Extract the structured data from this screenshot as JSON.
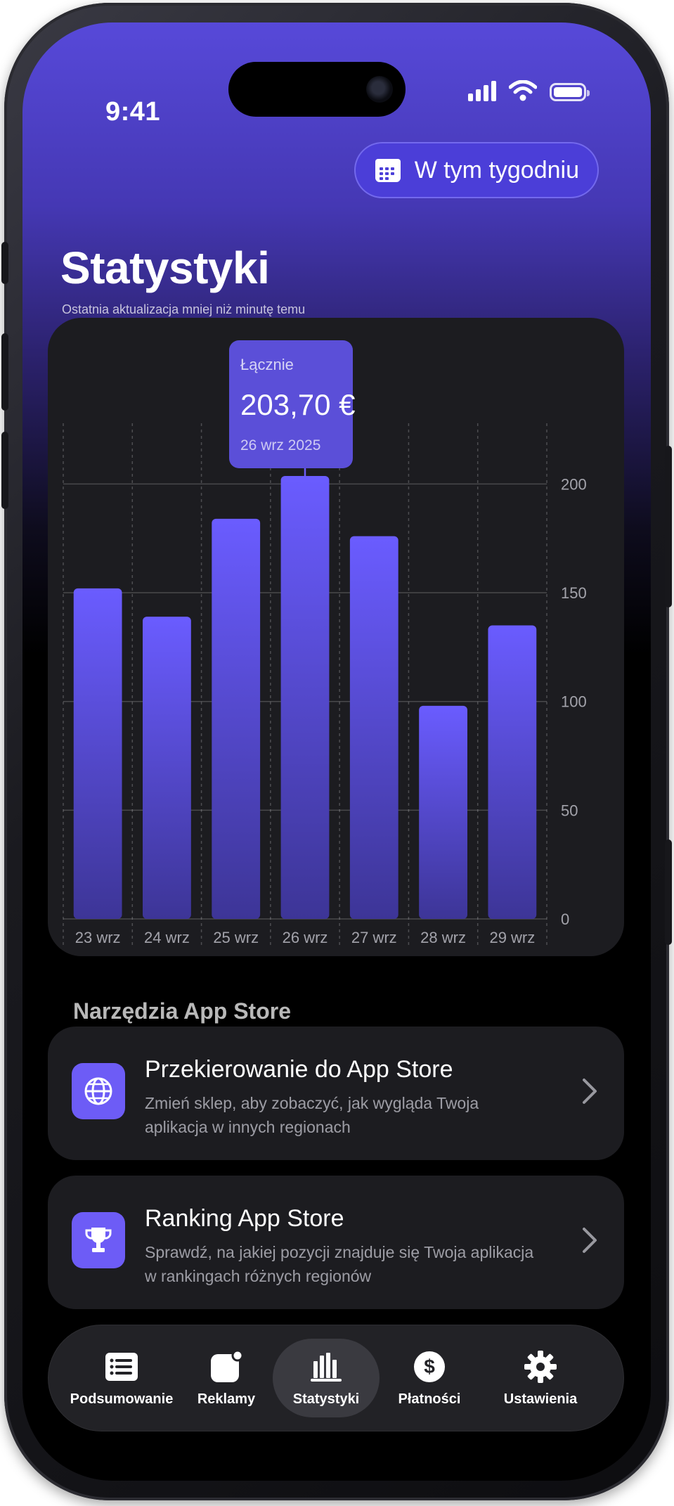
{
  "status_bar": {
    "time": "9:41"
  },
  "header": {
    "range_button": "W tym tygodniu",
    "title": "Statystyki",
    "subtitle": "Ostatnia aktualizacja mniej niż minutę temu"
  },
  "tooltip": {
    "label": "Łącznie",
    "value": "203,70 €",
    "date": "26 wrz 2025"
  },
  "chart_data": {
    "type": "bar",
    "categories": [
      "23 wrz",
      "24 wrz",
      "25 wrz",
      "26 wrz",
      "27 wrz",
      "28 wrz",
      "29 wrz"
    ],
    "values": [
      152,
      139,
      184,
      203.7,
      176,
      98,
      135
    ],
    "ylim": [
      0,
      215
    ],
    "yticks": [
      0,
      50,
      100,
      150,
      200
    ],
    "selected_index": 3,
    "bar_color_top": "#6a5cff",
    "bar_color_bottom": "#3d3597",
    "grid": true,
    "y_axis_position": "right"
  },
  "tools": {
    "section_title": "Narzędzia App Store",
    "items": [
      {
        "title": "Przekierowanie do App Store",
        "description": "Zmień sklep, aby zobaczyć, jak wygląda Twoja aplikacja w innych regionach",
        "icon": "globe-icon"
      },
      {
        "title": "Ranking App Store",
        "description": "Sprawdź, na jakiej pozycji znajduje się Twoja aplikacja w rankingach różnych regionów",
        "icon": "trophy-icon"
      }
    ]
  },
  "tabbar": {
    "items": [
      {
        "label": "Podsumowanie",
        "icon": "list-icon"
      },
      {
        "label": "Reklamy",
        "icon": "app-badge-icon"
      },
      {
        "label": "Statystyki",
        "icon": "bar-chart-icon",
        "active": true
      },
      {
        "label": "Płatności",
        "icon": "dollar-icon"
      },
      {
        "label": "Ustawienia",
        "icon": "gear-icon"
      }
    ]
  },
  "colors": {
    "accent": "#6d5cf6",
    "header_gradient_top": "#5749d9",
    "card_background": "#1c1c20",
    "tooltip_background": "#5b4fd8"
  }
}
